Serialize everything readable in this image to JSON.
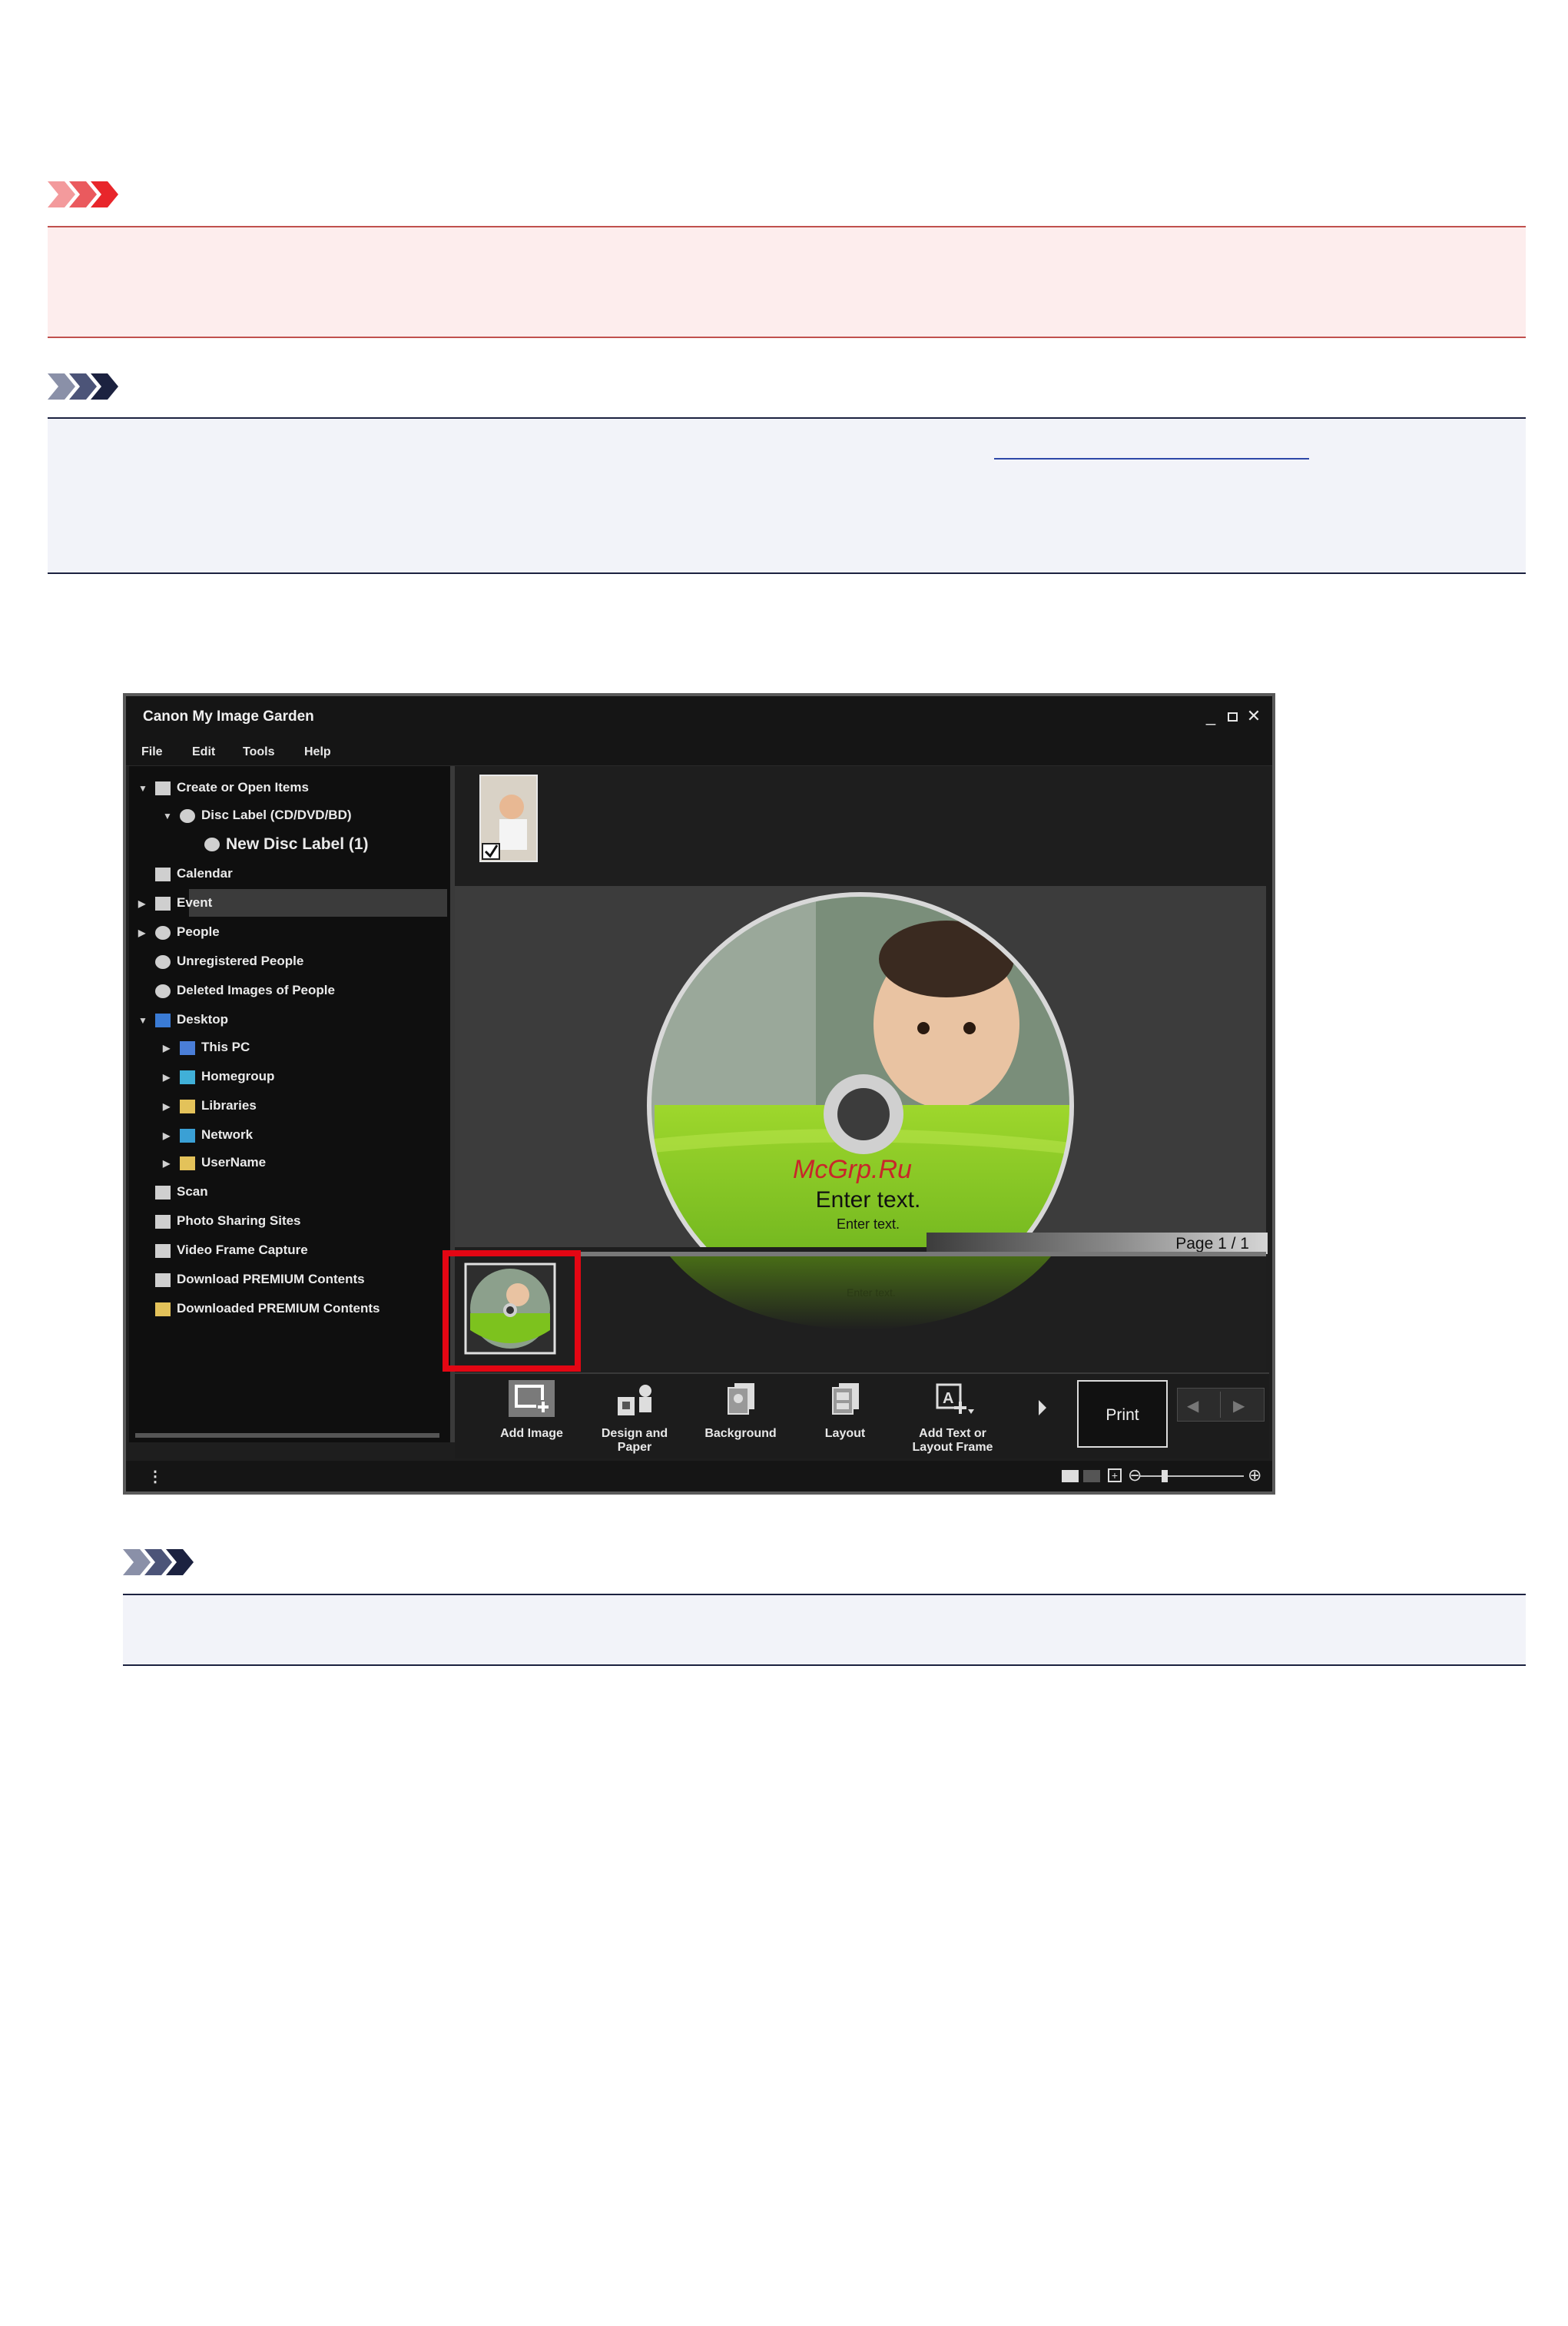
{
  "app": {
    "title": "Canon My Image Garden",
    "window_controls": [
      "minimize-icon",
      "maximize-icon",
      "close-icon"
    ],
    "menu": [
      "File",
      "Edit",
      "Tools",
      "Help"
    ],
    "tree": [
      {
        "label": "Create or Open Items",
        "level": 0,
        "expanded": true,
        "icon": "create-items-icon"
      },
      {
        "label": "Disc Label (CD/DVD/BD)",
        "level": 1,
        "expanded": true,
        "icon": "disc-icon"
      },
      {
        "label": "New Disc Label (1)",
        "level": 2,
        "selected": true,
        "icon": "disc-icon"
      },
      {
        "label": "Calendar",
        "level": 0,
        "icon": "calendar-icon"
      },
      {
        "label": "Event",
        "level": 0,
        "collapsed": true,
        "icon": "event-icon"
      },
      {
        "label": "People",
        "level": 0,
        "collapsed": true,
        "icon": "person-icon"
      },
      {
        "label": "Unregistered People",
        "level": 0,
        "icon": "person-icon"
      },
      {
        "label": "Deleted Images of People",
        "level": 0,
        "icon": "person-outline-icon"
      },
      {
        "label": "Desktop",
        "level": 0,
        "expanded": true,
        "icon": "desktop-icon"
      },
      {
        "label": "This PC",
        "level": 1,
        "collapsed": true,
        "icon": "pc-icon"
      },
      {
        "label": "Homegroup",
        "level": 1,
        "collapsed": true,
        "icon": "homegroup-icon"
      },
      {
        "label": "Libraries",
        "level": 1,
        "collapsed": true,
        "icon": "folder-icon"
      },
      {
        "label": "Network",
        "level": 1,
        "collapsed": true,
        "icon": "network-icon"
      },
      {
        "label": "UserName",
        "level": 1,
        "collapsed": true,
        "icon": "user-folder-icon"
      },
      {
        "label": "Scan",
        "level": 0,
        "icon": "scan-icon"
      },
      {
        "label": "Photo Sharing Sites",
        "level": 0,
        "icon": "photo-sharing-icon"
      },
      {
        "label": "Video Frame Capture",
        "level": 0,
        "icon": "video-icon"
      },
      {
        "label": "Download PREMIUM Contents",
        "level": 0,
        "icon": "download-icon"
      },
      {
        "label": "Downloaded PREMIUM Contents",
        "level": 0,
        "icon": "folder-icon"
      }
    ],
    "disc": {
      "text_large": "Enter text.",
      "text_small": "Enter text.",
      "text_reflection": "Enter text.",
      "watermark": "McGrp.Ru"
    },
    "page_label": "Page 1 / 1",
    "toolbar": {
      "add_image": "Add Image",
      "design_paper_1": "Design and",
      "design_paper_2": "Paper",
      "background": "Background",
      "layout": "Layout",
      "add_text_1": "Add Text or",
      "add_text_2": "Layout Frame",
      "print": "Print"
    }
  },
  "colors": {
    "important_accent": "#e8262b",
    "note_accent": "#1c2240",
    "highlight_red": "#e30613",
    "disc_green": "#7dc21e"
  }
}
